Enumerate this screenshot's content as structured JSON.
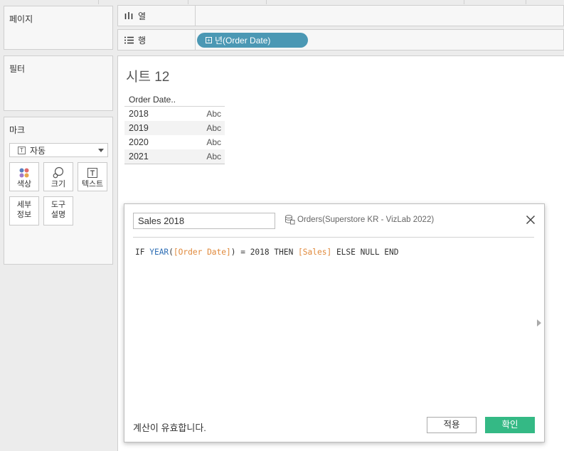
{
  "panels": {
    "pages_title": "페이지",
    "filters_title": "필터",
    "marks": {
      "title": "마크",
      "mark_type": "자동",
      "buttons": [
        {
          "label": "색상",
          "icon": "color-dots-icon"
        },
        {
          "label": "크기",
          "icon": "size-icon"
        },
        {
          "label": "텍스트",
          "icon": "text-icon"
        },
        {
          "label_line1": "세부",
          "label_line2": "정보",
          "icon": "none"
        },
        {
          "label_line1": "도구",
          "label_line2": "설명",
          "icon": "none"
        }
      ]
    }
  },
  "shelves": {
    "columns_label": "열",
    "rows_label": "행",
    "row_pill": "년(Order Date)"
  },
  "sheet": {
    "title": "시트 12",
    "table": {
      "header": "Order Date..",
      "rows": [
        {
          "year": "2018",
          "value": "Abc"
        },
        {
          "year": "2019",
          "value": "Abc"
        },
        {
          "year": "2020",
          "value": "Abc"
        },
        {
          "year": "2021",
          "value": "Abc"
        }
      ]
    }
  },
  "calc_dialog": {
    "name_value": "Sales 2018",
    "datasource": "Orders(Superstore KR - VizLab 2022)",
    "formula_parts": {
      "if": "IF ",
      "fn": "YEAR",
      "open": "(",
      "field1": "[Order Date]",
      "mid": ") = 2018 THEN ",
      "field2": "[Sales]",
      "tail": " ELSE NULL END"
    },
    "status": "계산이 유효합니다.",
    "apply_label": "적용",
    "ok_label": "확인"
  },
  "colors": {
    "pill": "#4b98b4",
    "ok_button": "#34b985",
    "function": "#2f6fb5",
    "field": "#e0893b"
  }
}
